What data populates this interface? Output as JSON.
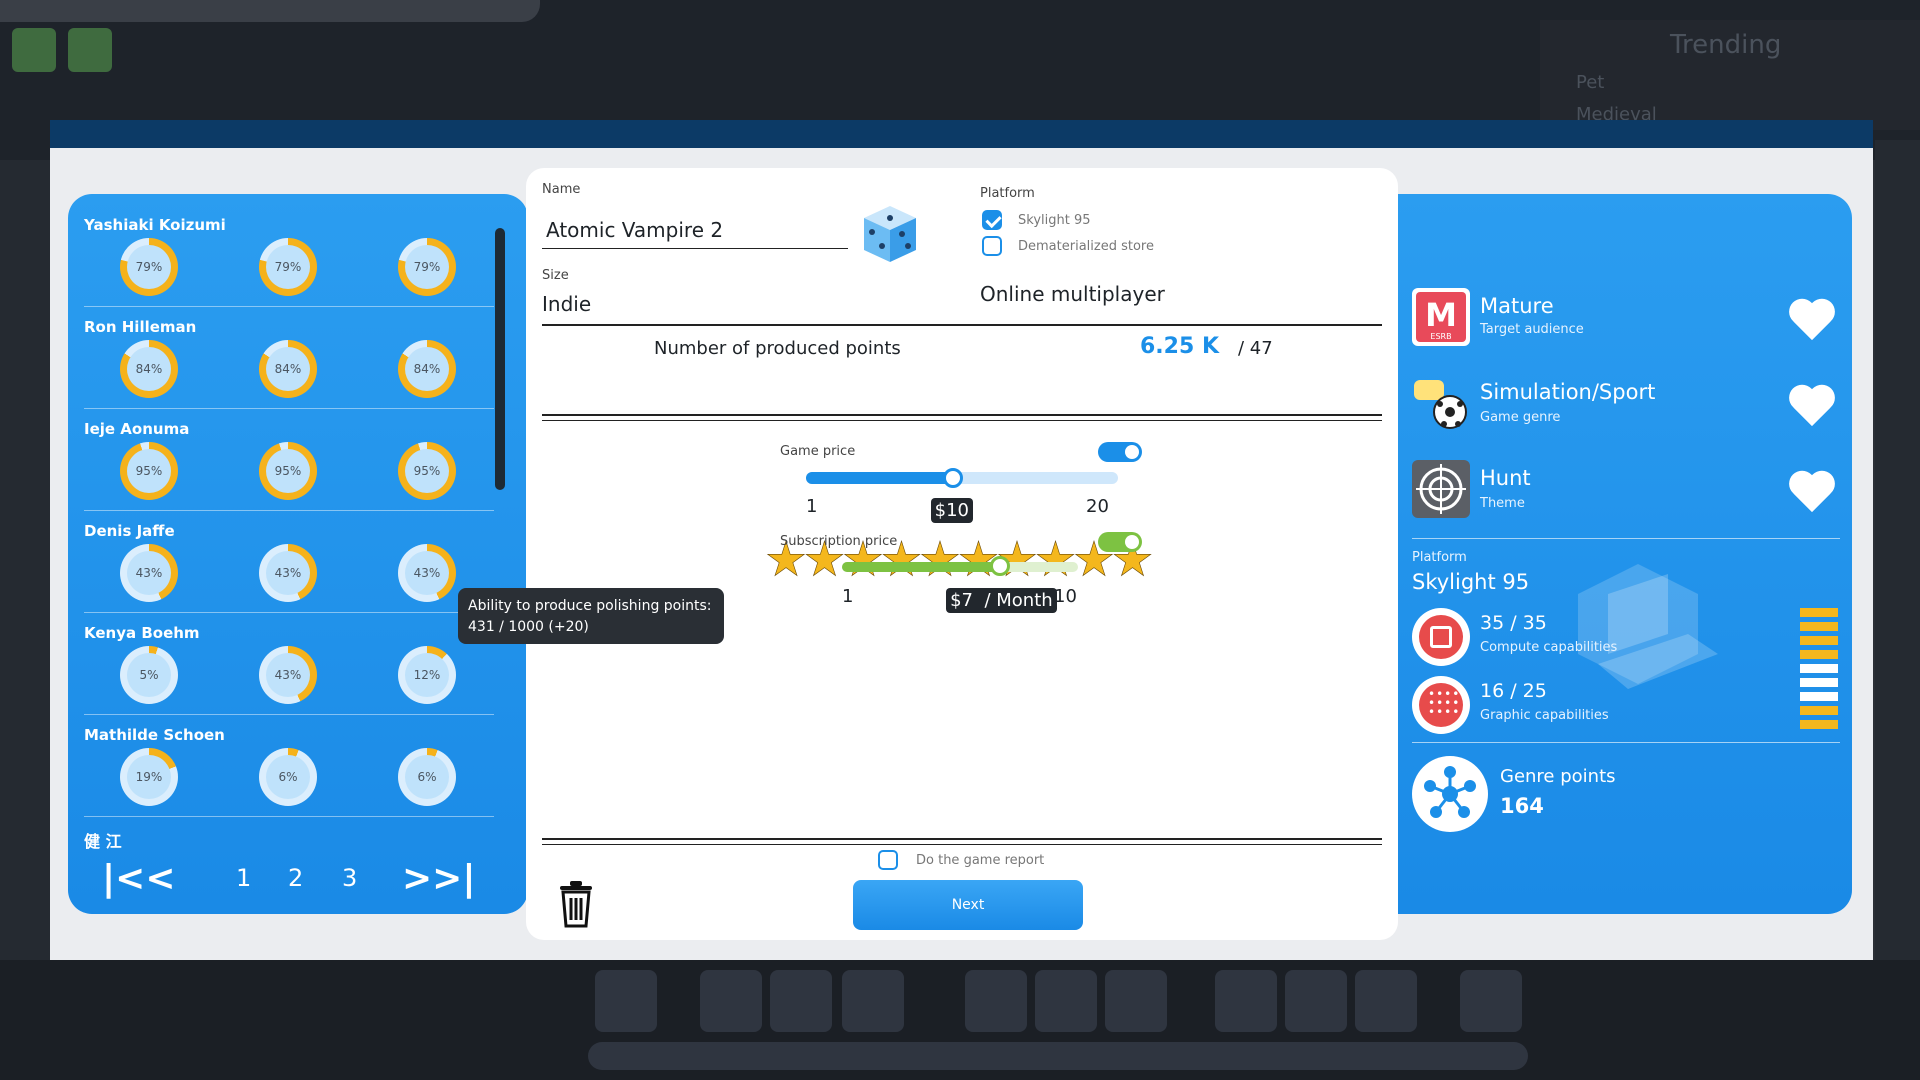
{
  "background": {
    "trending_title": "Trending",
    "trending_items": [
      "Pet",
      "Medieval"
    ]
  },
  "developers": [
    {
      "name": "Yashiaki Koizumi",
      "skills": [
        "79%",
        "79%",
        "79%"
      ]
    },
    {
      "name": "Ron Hilleman",
      "skills": [
        "84%",
        "84%",
        "84%"
      ]
    },
    {
      "name": "Ieje Aonuma",
      "skills": [
        "95%",
        "95%",
        "95%"
      ]
    },
    {
      "name": "Denis Jaffe",
      "skills": [
        "43%",
        "43%",
        "43%"
      ]
    },
    {
      "name": "Kenya Boehm",
      "skills": [
        "5%",
        "43%",
        "12%"
      ]
    },
    {
      "name": "Mathilde Schoen",
      "skills": [
        "19%",
        "6%",
        "6%"
      ]
    }
  ],
  "developers_partial_name": "健 江",
  "pager": {
    "first": "|<<",
    "pages": [
      "1",
      "2",
      "3"
    ],
    "last": ">>|"
  },
  "tooltip": {
    "line1": "Ability to produce polishing points:",
    "line2": "431 / 1000 (+20)"
  },
  "form": {
    "name_label": "Name",
    "name_value": "Atomic Vampire 2",
    "size_label": "Size",
    "size_value": "Indie",
    "platform_label": "Platform",
    "platforms": [
      {
        "label": "Skylight 95",
        "checked": true
      },
      {
        "label": "Dematerialized store",
        "checked": false
      }
    ],
    "online_multiplayer": "Online multiplayer",
    "points_label": "Number of produced points",
    "points_value": "6.25 K",
    "points_total": "/ 47",
    "stars": 10,
    "game_price_label": "Game price",
    "game_price_min": "1",
    "game_price_max": "20",
    "game_price_value": "$10",
    "game_price_fraction": 0.47,
    "subscription_label": "Subscription price",
    "subscription_min": "1",
    "subscription_max": "10",
    "subscription_value": "$7  / Month",
    "subscription_fraction": 0.67,
    "report_label": "Do the game report",
    "next_label": "Next"
  },
  "right": {
    "audience_title": "Mature",
    "audience_sub": "Target audience",
    "genre_title": "Simulation/Sport",
    "genre_sub": "Game genre",
    "theme_title": "Hunt",
    "theme_sub": "Theme",
    "platform_label": "Platform",
    "platform_value": "Skylight 95",
    "compute_value": "35 / 35",
    "compute_label": "Compute capabilities",
    "graphic_value": "16 / 25",
    "graphic_label": "Graphic capabilities",
    "genre_points_label": "Genre points",
    "genre_points_value": "164",
    "esrb_text": "ESRB"
  },
  "colors": {
    "accent_blue": "#1b8fe8",
    "accent_green": "#7dc242",
    "star_gold": "#f4b71d",
    "red": "#e74b4b"
  }
}
